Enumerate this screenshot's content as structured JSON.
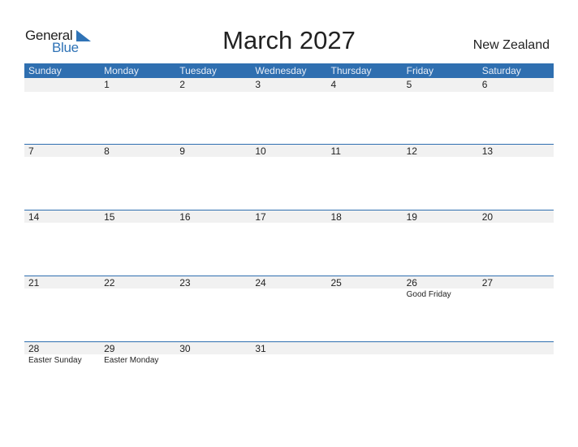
{
  "logo": {
    "word1": "General",
    "word2": "Blue"
  },
  "title": "March 2027",
  "country": "New Zealand",
  "colors": {
    "accent": "#2f6fb0",
    "row_bg": "#f1f1f1"
  },
  "weekdays": [
    "Sunday",
    "Monday",
    "Tuesday",
    "Wednesday",
    "Thursday",
    "Friday",
    "Saturday"
  ],
  "weeks": [
    {
      "days": [
        {
          "num": "",
          "hol": ""
        },
        {
          "num": "1",
          "hol": ""
        },
        {
          "num": "2",
          "hol": ""
        },
        {
          "num": "3",
          "hol": ""
        },
        {
          "num": "4",
          "hol": ""
        },
        {
          "num": "5",
          "hol": ""
        },
        {
          "num": "6",
          "hol": ""
        }
      ]
    },
    {
      "days": [
        {
          "num": "7",
          "hol": ""
        },
        {
          "num": "8",
          "hol": ""
        },
        {
          "num": "9",
          "hol": ""
        },
        {
          "num": "10",
          "hol": ""
        },
        {
          "num": "11",
          "hol": ""
        },
        {
          "num": "12",
          "hol": ""
        },
        {
          "num": "13",
          "hol": ""
        }
      ]
    },
    {
      "days": [
        {
          "num": "14",
          "hol": ""
        },
        {
          "num": "15",
          "hol": ""
        },
        {
          "num": "16",
          "hol": ""
        },
        {
          "num": "17",
          "hol": ""
        },
        {
          "num": "18",
          "hol": ""
        },
        {
          "num": "19",
          "hol": ""
        },
        {
          "num": "20",
          "hol": ""
        }
      ]
    },
    {
      "days": [
        {
          "num": "21",
          "hol": ""
        },
        {
          "num": "22",
          "hol": ""
        },
        {
          "num": "23",
          "hol": ""
        },
        {
          "num": "24",
          "hol": ""
        },
        {
          "num": "25",
          "hol": ""
        },
        {
          "num": "26",
          "hol": "Good Friday"
        },
        {
          "num": "27",
          "hol": ""
        }
      ]
    },
    {
      "days": [
        {
          "num": "28",
          "hol": "Easter Sunday"
        },
        {
          "num": "29",
          "hol": "Easter Monday"
        },
        {
          "num": "30",
          "hol": ""
        },
        {
          "num": "31",
          "hol": ""
        },
        {
          "num": "",
          "hol": ""
        },
        {
          "num": "",
          "hol": ""
        },
        {
          "num": "",
          "hol": ""
        }
      ]
    }
  ]
}
